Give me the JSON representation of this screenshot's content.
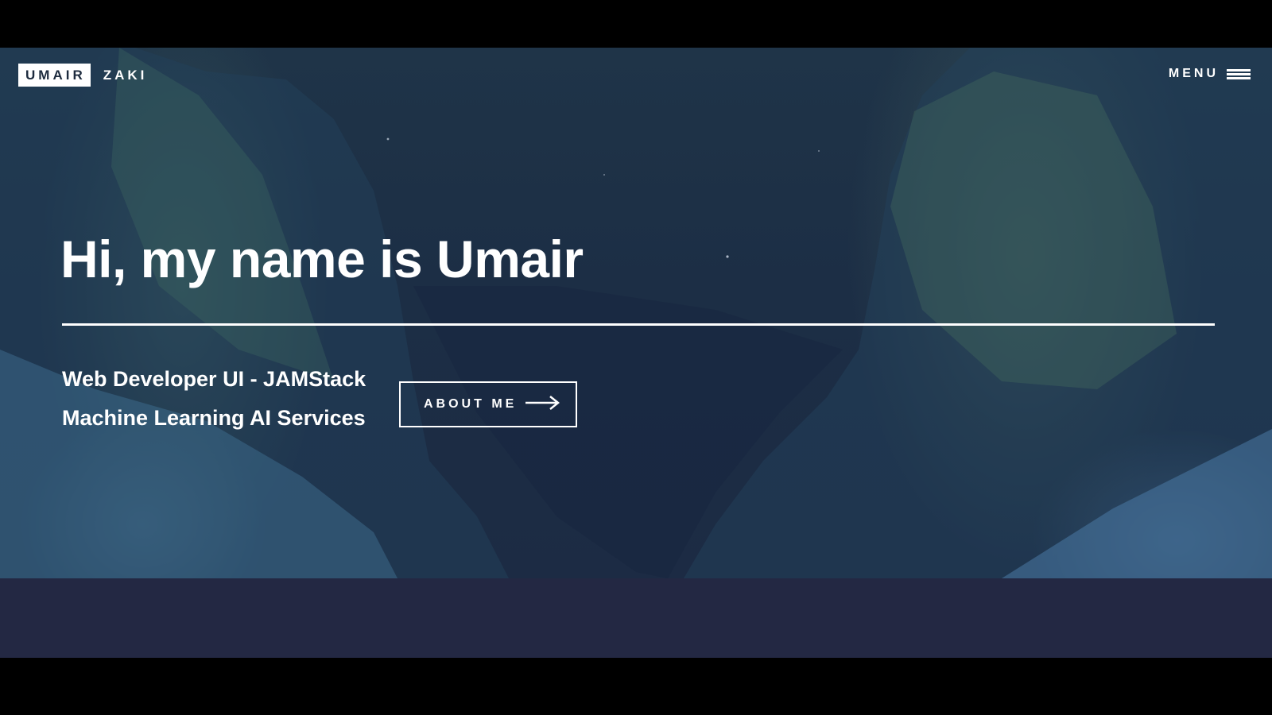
{
  "header": {
    "logo_first": "UMAIR",
    "logo_last": "ZAKI",
    "menu_label": "MENU"
  },
  "hero": {
    "headline": "Hi, my name is Umair",
    "taglines": [
      "Web Developer UI - JAMStack",
      "Machine Learning AI Services"
    ],
    "cta_label": "ABOUT ME",
    "cta_icon": "arrow-right-icon"
  },
  "colors": {
    "hero_tint": "#1c2b44",
    "band": "#232843",
    "text": "#ffffff"
  }
}
